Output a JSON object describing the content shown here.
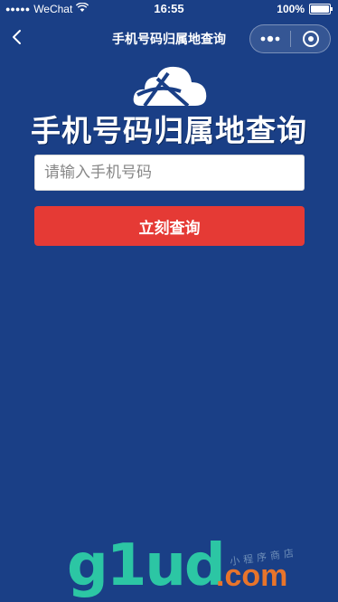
{
  "status_bar": {
    "signal": "●●●●●",
    "carrier": "WeChat",
    "time": "16:55",
    "battery_percent": "100%"
  },
  "nav": {
    "title": "手机号码归属地查询"
  },
  "app": {
    "headline": "手机号码归属地查询",
    "input_placeholder": "请输入手机号码",
    "input_value": "",
    "submit_label": "立刻查询"
  },
  "watermark": {
    "brand": "g1ud",
    "tld": ".com",
    "tagline": "小程序商店"
  },
  "colors": {
    "background": "#1a3f86",
    "button": "#e53a35",
    "watermark_main": "#2cc6a4",
    "watermark_accent": "#e8742b"
  }
}
